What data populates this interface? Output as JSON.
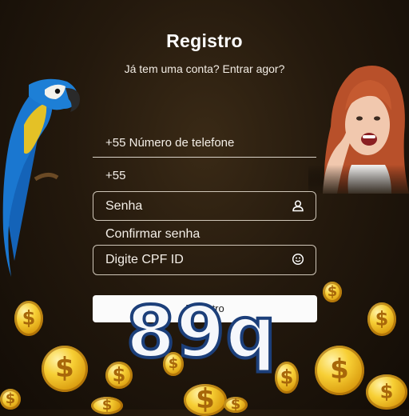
{
  "header": {
    "title": "Registro",
    "subtitle": "Já tem uma conta? Entrar agor?"
  },
  "form": {
    "phone_label": "+55 Número de telefone",
    "phone_prefix": "+55",
    "password_placeholder": "Senha",
    "confirm_label": "Confirmar senha",
    "cpf_placeholder": "Digite CPF ID",
    "submit_label": "Registro"
  },
  "brand": {
    "logo_text": "89q"
  },
  "icons": {
    "password": "user-icon",
    "cpf": "smile-icon"
  },
  "colors": {
    "background": "#24190d",
    "coin_gold": "#f7cf35",
    "logo_outline": "#1c3f7a"
  }
}
